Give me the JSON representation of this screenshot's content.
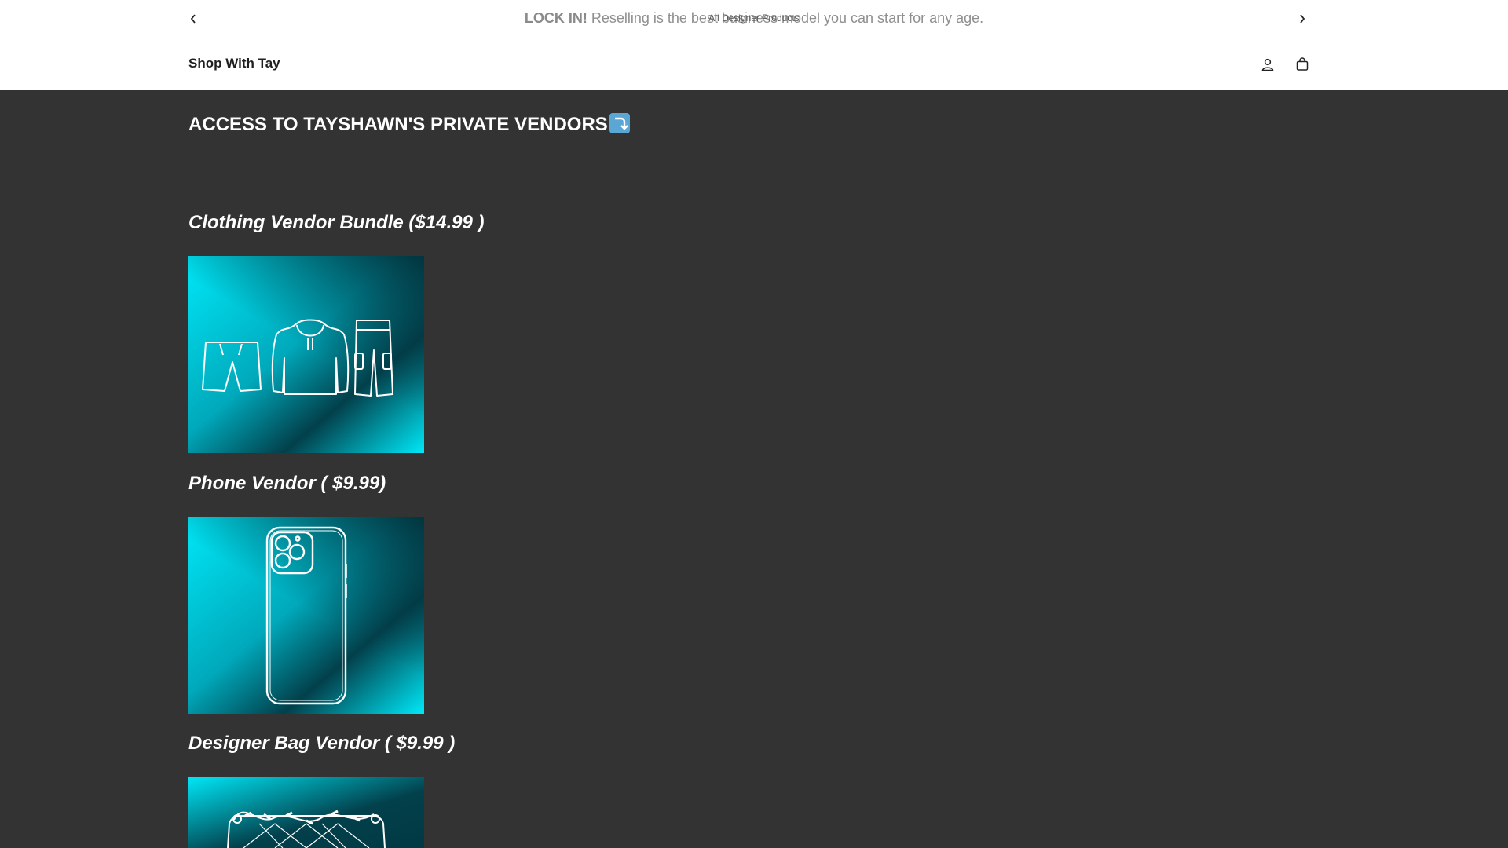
{
  "announcement": {
    "bold": "LOCK IN!",
    "text": " Reselling is the best business model you can start for any age.",
    "overlay": "All Designer Products"
  },
  "header": {
    "logo": "Shop With Tay",
    "icons": [
      "account-icon",
      "cart-icon"
    ]
  },
  "main": {
    "title": "ACCESS TO TAYSHAWN'S PRIVATE VENDORS",
    "title_emoji": "arrow-down-right-emoji",
    "sections": [
      {
        "title": "Clothing Vendor Bundle ($14.99 )",
        "image": "clothing-outline-image"
      },
      {
        "title": "Phone Vendor ( $9.99)",
        "image": "phone-outline-image"
      },
      {
        "title": "Designer Bag Vendor ( $9.99 )",
        "image": "bag-outline-image"
      }
    ]
  },
  "colors": {
    "background": "#333333",
    "tile_cyan": "#00e5f5",
    "tile_dark": "#003a44"
  }
}
